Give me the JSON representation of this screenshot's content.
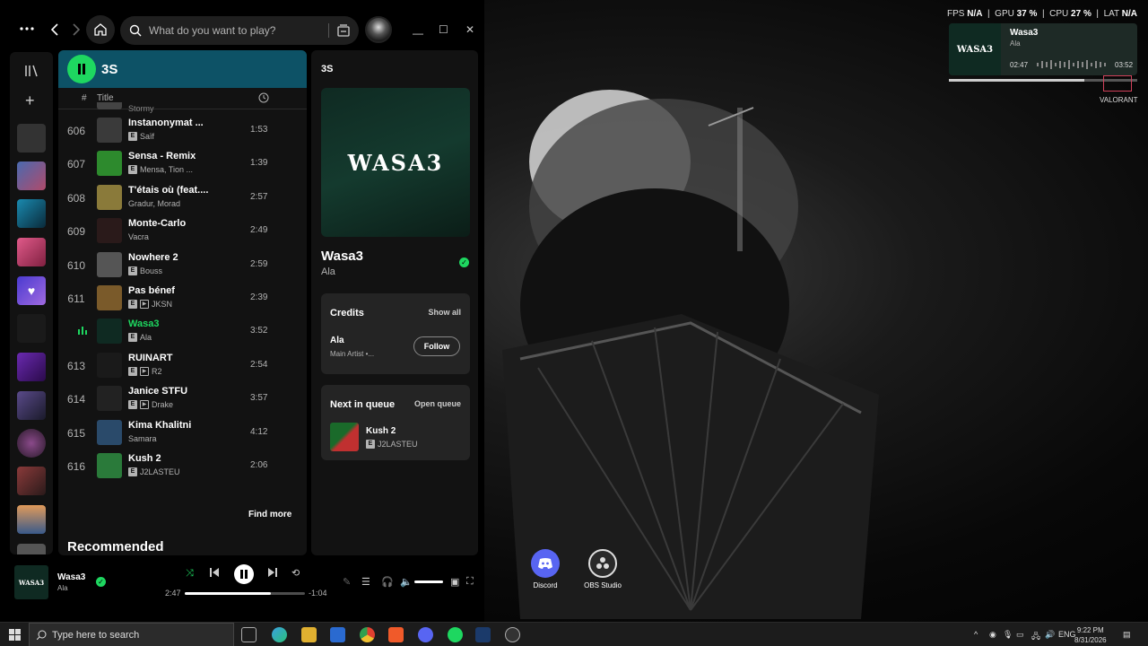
{
  "app": {
    "search_placeholder": "What do you want to play?"
  },
  "playlist": {
    "title": "3S",
    "col_title": "Title",
    "partial_row_artist": "Stormy",
    "tracks": [
      {
        "num": "606",
        "name": "Instanonymat ...",
        "artist": "Saïf",
        "dur": "1:53",
        "explicit": true,
        "video": false,
        "art": "#3a3a3a"
      },
      {
        "num": "607",
        "name": "Sensa - Remix",
        "artist": "Mensa, Tion ...",
        "dur": "1:39",
        "explicit": true,
        "video": false,
        "art": "#2d8a2d"
      },
      {
        "num": "608",
        "name": "T'étais où (feat....",
        "artist": "Gradur, Morad",
        "dur": "2:57",
        "explicit": false,
        "video": false,
        "art": "#8a7a3a"
      },
      {
        "num": "609",
        "name": "Monte-Carlo",
        "artist": "Vacra",
        "dur": "2:49",
        "explicit": false,
        "video": false,
        "art": "#2a1a1a"
      },
      {
        "num": "610",
        "name": "Nowhere 2",
        "artist": "Bouss",
        "dur": "2:59",
        "explicit": true,
        "video": false,
        "art": "#555555"
      },
      {
        "num": "611",
        "name": "Pas bénef",
        "artist": "JKSN",
        "dur": "2:39",
        "explicit": true,
        "video": true,
        "art": "#7a5a2a"
      },
      {
        "num": "",
        "name": "Wasa3",
        "artist": "Ala",
        "dur": "3:52",
        "explicit": true,
        "video": false,
        "art": "#0f2a22",
        "playing": true
      },
      {
        "num": "613",
        "name": "RUINART",
        "artist": "R2",
        "dur": "2:54",
        "explicit": true,
        "video": true,
        "art": "#1a1a1a"
      },
      {
        "num": "614",
        "name": "Janice STFU",
        "artist": "Drake",
        "dur": "3:57",
        "explicit": true,
        "video": true,
        "art": "#222222"
      },
      {
        "num": "615",
        "name": "Kima Khalitni",
        "artist": "Samara",
        "dur": "4:12",
        "explicit": false,
        "video": false,
        "art": "#2a4a6a"
      },
      {
        "num": "616",
        "name": "Kush 2",
        "artist": "J2LASTEU",
        "dur": "2:06",
        "explicit": true,
        "video": false,
        "art": "#2a7a3a"
      }
    ],
    "find_more": "Find more",
    "recommended": "Recommended"
  },
  "now_playing": {
    "panel_title": "3S",
    "cover_text": "WASA3",
    "song": "Wasa3",
    "artist": "Ala",
    "credits_title": "Credits",
    "show_all": "Show all",
    "credit_artist": "Ala",
    "credit_role": "Main Artist •...",
    "follow": "Follow",
    "queue_title": "Next in queue",
    "open_queue": "Open queue",
    "next_song": "Kush 2",
    "next_artist": "J2LASTEU"
  },
  "player": {
    "song": "Wasa3",
    "artist": "Ala",
    "elapsed": "2:47",
    "remaining": "-1:04",
    "progress": 0.72
  },
  "overlay": {
    "fps_label": "FPS",
    "fps_val": "N/A",
    "gpu_label": "GPU",
    "gpu_val": "37 %",
    "cpu_label": "CPU",
    "cpu_val": "27 %",
    "lat_label": "LAT",
    "lat_val": "N/A",
    "mini_song": "Wasa3",
    "mini_artist": "Ala",
    "mini_elapsed": "02:47",
    "mini_total": "03:52",
    "mini_progress": 0.72,
    "valorant": "VALORANT"
  },
  "desktop_icons": {
    "discord": "Discord",
    "obs": "OBS Studio"
  },
  "taskbar": {
    "search": "Type here to search",
    "lang": "ENG",
    "time": "9:22 PM",
    "date": "8/31/2026"
  },
  "colors": {
    "accent": "#1ed760",
    "header_teal": "#0d5266"
  }
}
